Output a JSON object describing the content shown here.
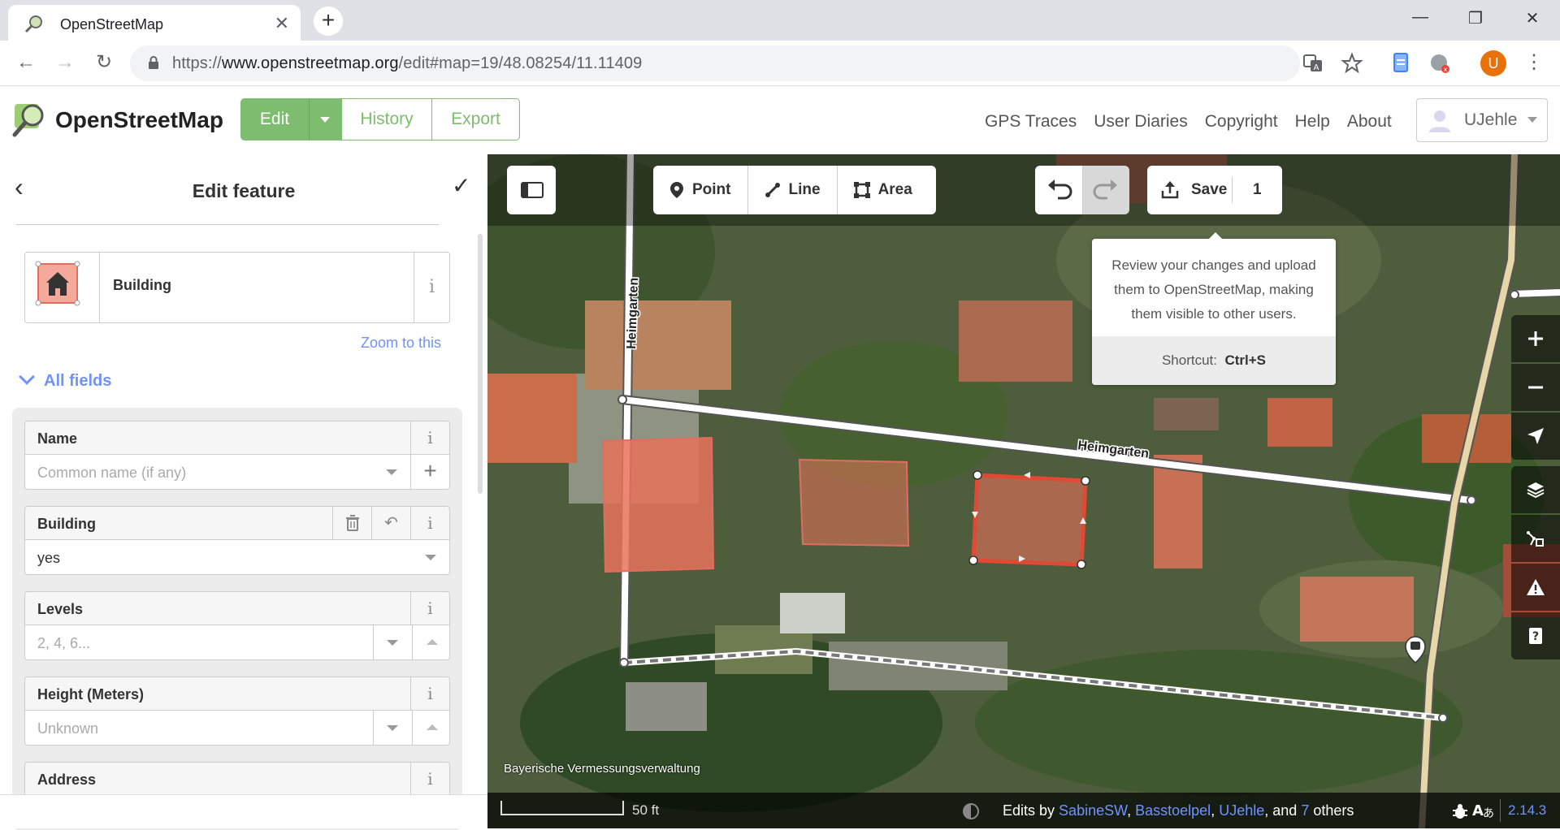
{
  "browser": {
    "tab_title": "OpenStreetMap",
    "url_scheme": "https://",
    "url_host": "www.openstreetmap.org",
    "url_path": "/edit#map=19/48.08254/11.11409",
    "profile_initial": "U",
    "profile_color": "#e8710a"
  },
  "osm": {
    "brand": "OpenStreetMap",
    "edit_label": "Edit",
    "history_label": "History",
    "export_label": "Export",
    "links": [
      "GPS Traces",
      "User Diaries",
      "Copyright",
      "Help",
      "About"
    ],
    "username": "UJehle",
    "accent": "#7ebc6f"
  },
  "sidebar": {
    "title": "Edit feature",
    "preset_name": "Building",
    "zoom_link": "Zoom to this",
    "all_fields": "All fields",
    "fields": [
      {
        "label": "Name",
        "value": "",
        "placeholder": "Common name (if any)"
      },
      {
        "label": "Building",
        "value": "yes",
        "placeholder": ""
      },
      {
        "label": "Levels",
        "value": "",
        "placeholder": "2, 4, 6..."
      },
      {
        "label": "Height (Meters)",
        "value": "",
        "placeholder": "Unknown"
      },
      {
        "label": "Address",
        "value": "",
        "placeholder": ""
      }
    ]
  },
  "map": {
    "modes": [
      "Point",
      "Line",
      "Area"
    ],
    "save_label": "Save",
    "save_count": "1",
    "tooltip_text": "Review your changes and upload them to OpenStreetMap, making them visible to other users.",
    "tooltip_shortcut_label": "Shortcut:",
    "tooltip_shortcut_key": "Ctrl+S",
    "street_name_1": "Heimgarten",
    "street_name_2": "Heimgarten",
    "attribution": "Bayerische Vermessungsverwaltung",
    "scale_label": "50 ft",
    "edits_prefix": "Edits by",
    "edits_users": [
      "SabineSW",
      "Basstoelpel",
      "UJehle"
    ],
    "edits_and": "and",
    "edits_others_count": "7",
    "edits_others": "others",
    "version": "2.14.3"
  }
}
